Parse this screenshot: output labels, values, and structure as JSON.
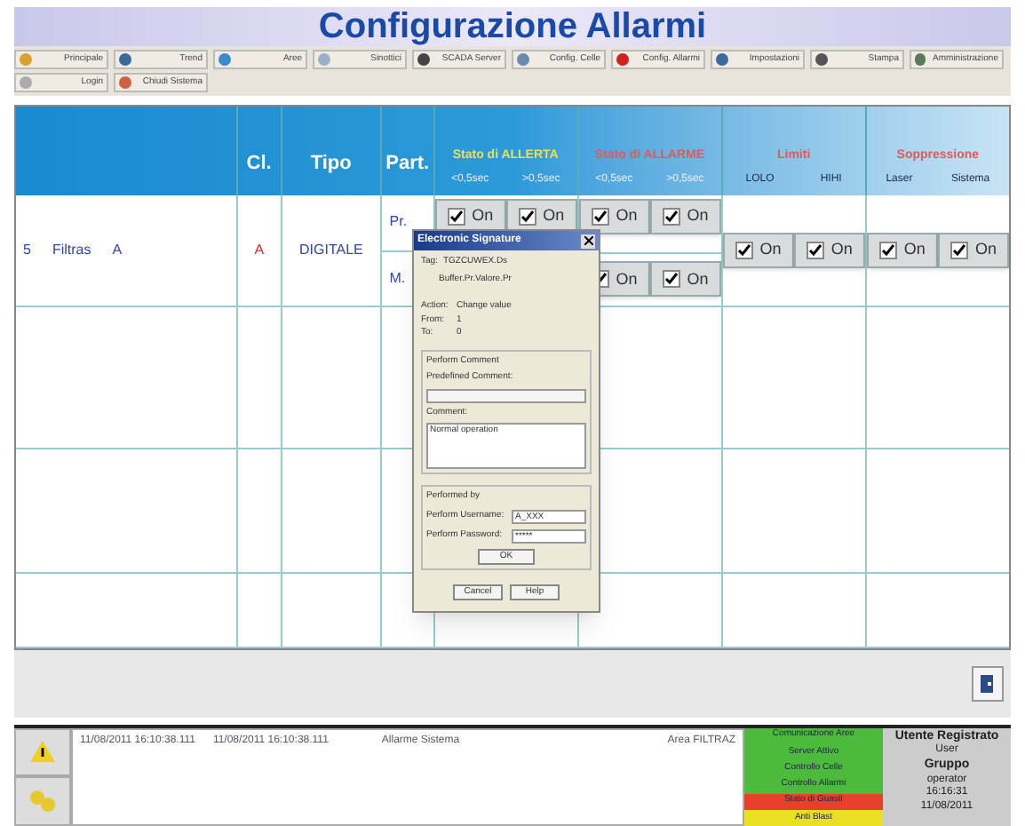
{
  "title": "Configurazione Allarmi",
  "toolbar": [
    {
      "label": "Principale"
    },
    {
      "label": "Trend"
    },
    {
      "label": "Aree"
    },
    {
      "label": "Sinottici"
    },
    {
      "label": "SCADA Server"
    },
    {
      "label": "Config. Celle"
    },
    {
      "label": "Config. Allarmi"
    },
    {
      "label": "Impostazioni"
    },
    {
      "label": "Stampa"
    },
    {
      "label": "Amministrazione"
    }
  ],
  "toolbar2": [
    {
      "label": "Login"
    },
    {
      "label": "Chiudi Sistema"
    }
  ],
  "table": {
    "columns": [
      "Cl.",
      "Tipo",
      "Part."
    ],
    "groups": [
      {
        "title": "Stato di ALLERTA",
        "color": "#e8e05a",
        "subs": [
          "<0,5sec",
          ">0,5sec"
        ]
      },
      {
        "title": "Stato di ALLARME",
        "color": "#e05a5a",
        "subs": [
          "<0,5sec",
          ">0,5sec"
        ]
      },
      {
        "title": "Limiti",
        "color": "#e05a5a",
        "subs": [
          "LOLO",
          "HIHI"
        ]
      },
      {
        "title": "Soppressione",
        "color": "#e05a5a",
        "subs": [
          "Laser",
          "Sistema"
        ]
      }
    ],
    "rows": [
      {
        "id": "5",
        "name": "Filtras",
        "area": "A",
        "cl": "A",
        "tipo": "DIGITALE",
        "parts": [
          "Pr.",
          "M."
        ],
        "alerta": [
          [
            {
              "label": "On",
              "checked": true
            },
            {
              "label": "On",
              "checked": true
            }
          ]
        ],
        "allarme": [
          [
            {
              "label": "On",
              "checked": true
            },
            {
              "label": "On",
              "checked": true
            }
          ],
          [
            {
              "label": "On",
              "checked": true
            },
            {
              "label": "On",
              "checked": true
            }
          ]
        ],
        "limiti": [
          {
            "label": "On",
            "checked": true
          },
          {
            "label": "On",
            "checked": true
          }
        ],
        "soppressione": [
          {
            "label": "On",
            "checked": true
          },
          {
            "label": "On",
            "checked": true
          }
        ]
      }
    ]
  },
  "dialog": {
    "title": "Electronic Signature",
    "tag_label": "Tag:",
    "tag": "TGZCUWEX.Ds",
    "tag2": "Buffer.Pr.Valore.Pr",
    "fields": [
      {
        "label": "Action:",
        "value": "Change value"
      },
      {
        "label": "From:",
        "value": "1"
      },
      {
        "label": "To:",
        "value": "0"
      }
    ],
    "comment_group": "Perform Comment",
    "predefined_label": "Predefined Comment:",
    "comment_label": "Comment:",
    "comment": "Normal operation",
    "performed_group": "Performed by",
    "username_label": "Perform Username:",
    "username": "A_XXX",
    "password_label": "Perform Password:",
    "password": "*****",
    "ok": "OK",
    "cancel": "Cancel",
    "help": "Help"
  },
  "alarms": [
    {
      "start": "11/08/2011 16:10:38.111",
      "end": "11/08/2011 16:10:38.111",
      "text": "Allarme Sistema",
      "area": "Area FILTRAZ"
    }
  ],
  "status": [
    {
      "label": "Comunicazione Aree",
      "color": "#4cbb3c"
    },
    {
      "label": "Server Attivo",
      "color": "#4cbb3c"
    },
    {
      "label": "Controllo Celle",
      "color": "#4cbb3c"
    },
    {
      "label": "Controllo Allarmi",
      "color": "#4cbb3c"
    },
    {
      "label": "Stato di Guasti",
      "color": "#e8402a"
    },
    {
      "label": "Anti Blast",
      "color": "#e8e020"
    }
  ],
  "user": {
    "title": "Utente Registrato",
    "name": "User",
    "group_label": "Gruppo",
    "group": "operator",
    "time": "16:16:31",
    "date": "11/08/2011"
  }
}
